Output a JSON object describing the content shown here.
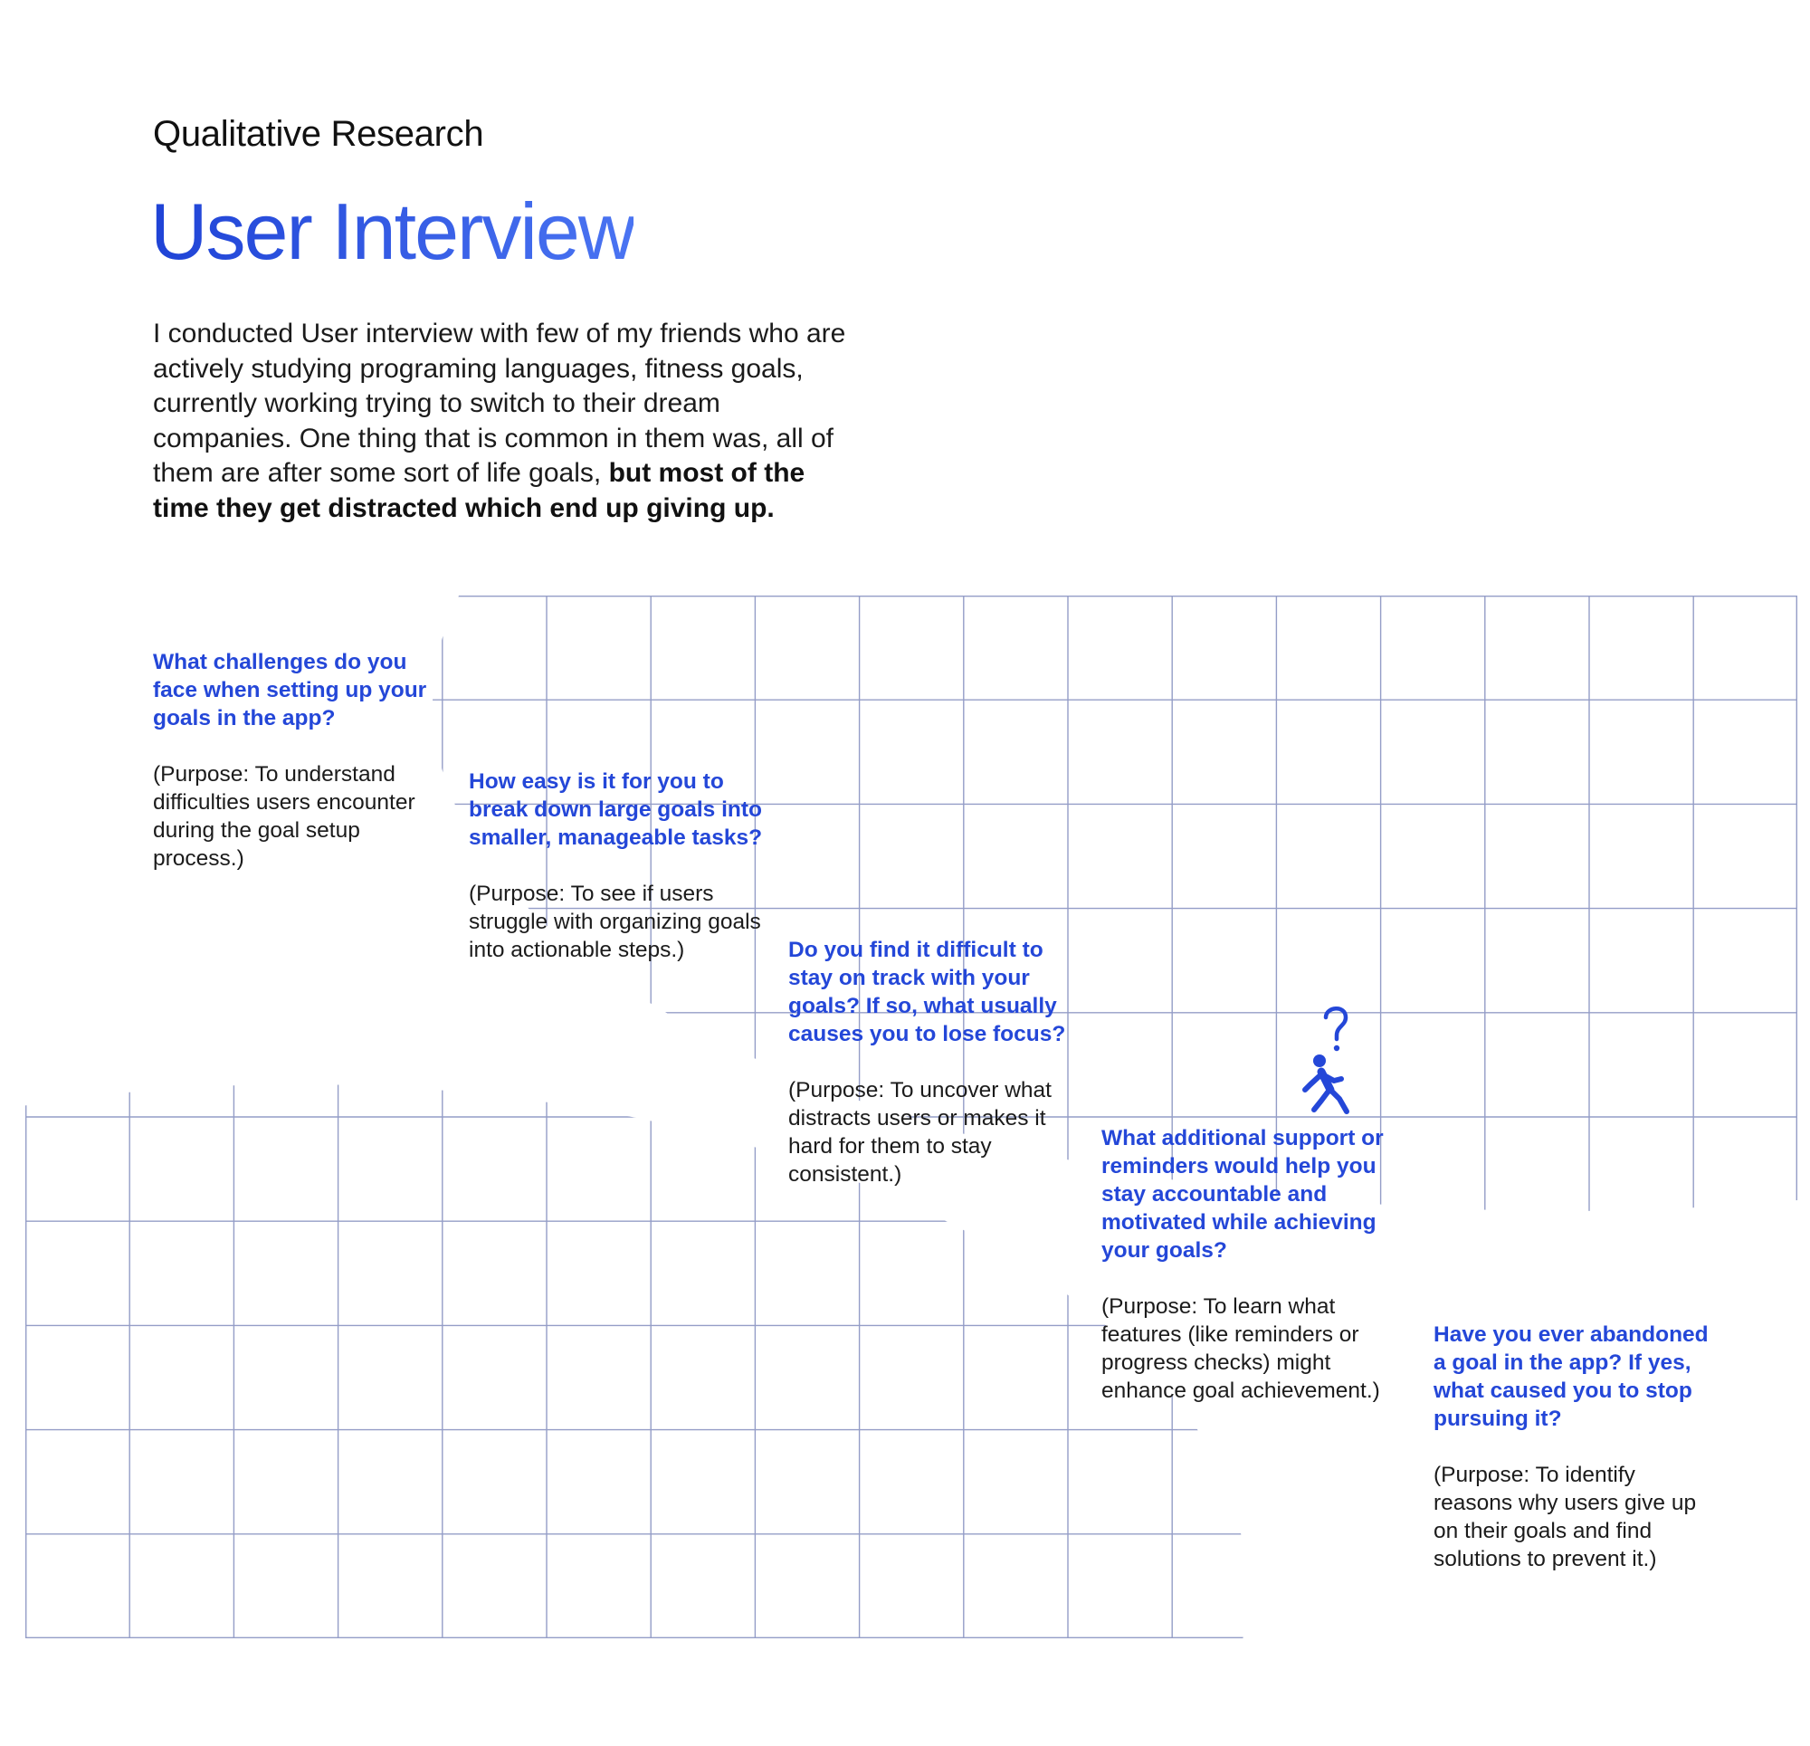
{
  "header": {
    "eyebrow": "Qualitative Research",
    "title": "User Interview"
  },
  "intro": {
    "text": "I conducted User interview with few of my friends who are actively studying programing languages, fitness goals, currently working trying to switch to their dream companies. One thing that is common in them was, all of them are after some sort of life goals, ",
    "emphasis": "but most of the time they get distracted which end up giving up."
  },
  "questions": [
    {
      "question": "What challenges do you face when setting up your goals in the app?",
      "purpose": "(Purpose: To understand difficulties users encounter during the goal setup process.)"
    },
    {
      "question": "How easy is it for you to break down large goals into smaller, manageable tasks?",
      "purpose": "(Purpose: To see if users struggle with organizing goals into actionable steps.)"
    },
    {
      "question": "Do you find it difficult to stay on track with your goals? If so, what usually causes you to lose focus?",
      "purpose": "(Purpose: To uncover what distracts users or makes it hard for them to stay consistent.)"
    },
    {
      "question": "What additional support or reminders would help you stay accountable and motivated while achieving your goals?",
      "purpose": "(Purpose: To learn what features (like reminders or progress checks) might enhance goal achievement.)"
    },
    {
      "question": "Have you ever abandoned a goal in the app? If yes, what caused you to stop pursuing it?",
      "purpose": "(Purpose: To identify reasons why users give up on their goals and find solutions to prevent it.)"
    }
  ],
  "icons": {
    "confused_walker": "person-walking-question-icon"
  },
  "colors": {
    "accent": "#2447d8",
    "title_gradient_start": "#1f43d6",
    "title_gradient_end": "#4a74f2",
    "grid_line": "#8e98c4",
    "body_text": "#1b1b1b"
  }
}
